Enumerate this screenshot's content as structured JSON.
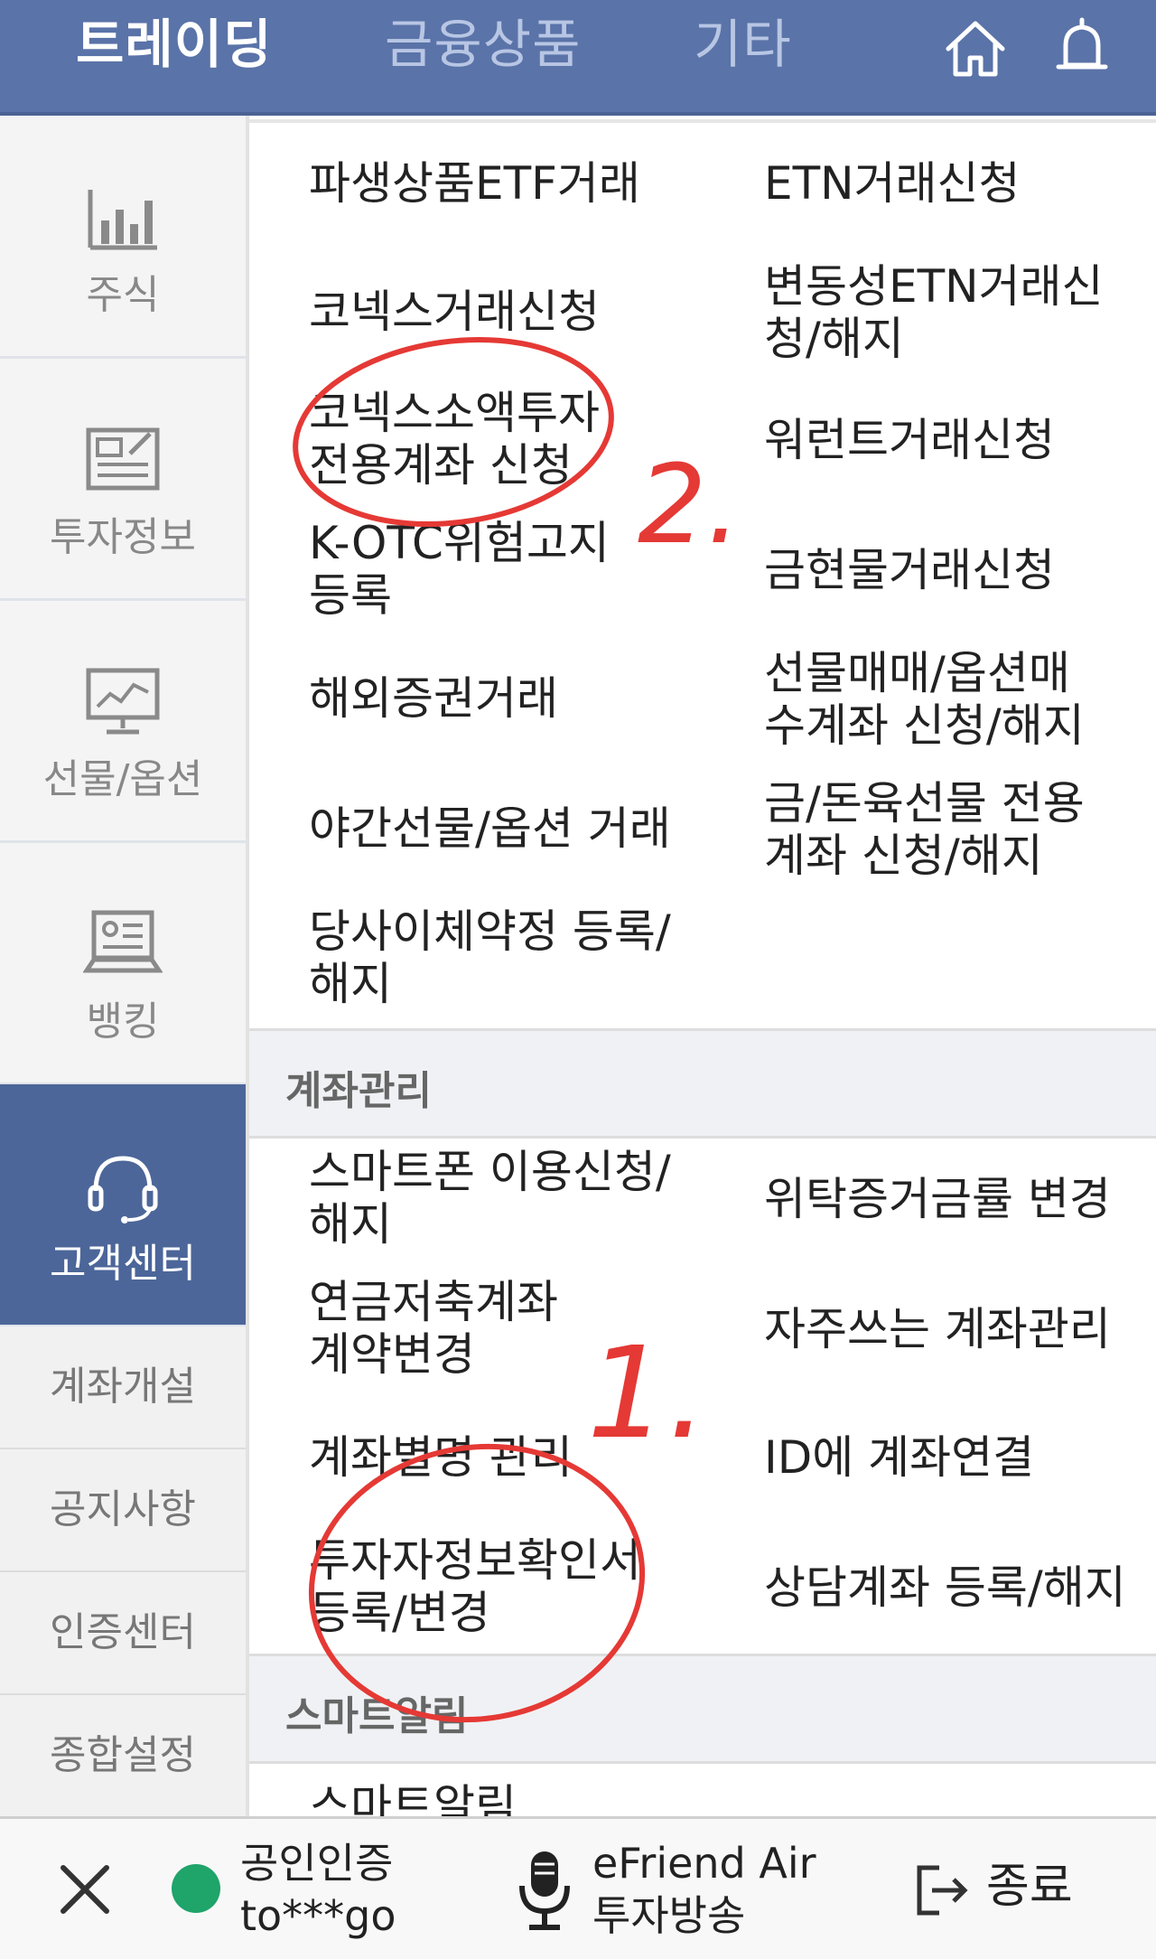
{
  "header": {
    "tabs": [
      {
        "label": "트레이딩",
        "active": true
      },
      {
        "label": "금융상품",
        "active": false
      },
      {
        "label": "기타",
        "active": false
      }
    ],
    "icons": [
      "home-icon",
      "bell-icon"
    ]
  },
  "sidebar": {
    "main_items": [
      {
        "label": "주식",
        "icon": "bar-chart-icon",
        "active": false
      },
      {
        "label": "투자정보",
        "icon": "news-icon",
        "active": false
      },
      {
        "label": "선물/옵션",
        "icon": "monitor-chart-icon",
        "active": false
      },
      {
        "label": "뱅킹",
        "icon": "laptop-card-icon",
        "active": false
      },
      {
        "label": "고객센터",
        "icon": "headset-icon",
        "active": true
      }
    ],
    "sub_items": [
      "계좌개설",
      "공지사항",
      "인증센터",
      "종합설정"
    ]
  },
  "content": {
    "group1": {
      "left": [
        [
          "파생상품ETF거래"
        ],
        [
          "코넥스거래신청"
        ],
        [
          "코넥스소액투자",
          "전용계좌 신청"
        ],
        [
          "K-OTC위험고지",
          "등록"
        ],
        [
          "해외증권거래"
        ],
        [
          "야간선물/옵션 거래"
        ],
        [
          "당사이체약정 등록/",
          "해지"
        ]
      ],
      "right": [
        [
          "ETN거래신청"
        ],
        [
          "변동성ETN거래신",
          "청/해지"
        ],
        [
          "워런트거래신청"
        ],
        [
          "금현물거래신청"
        ],
        [
          "선물매매/옵션매",
          "수계좌 신청/해지"
        ],
        [
          "금/돈육선물 전용",
          "계좌 신청/해지"
        ]
      ]
    },
    "section_account": "계좌관리",
    "group2": {
      "left": [
        [
          "스마트폰 이용신청/",
          "해지"
        ],
        [
          "연금저축계좌",
          "계약변경"
        ],
        [
          "계좌별명 관리"
        ],
        [
          "투자자정보확인서",
          "등록/변경"
        ]
      ],
      "right": [
        [
          "위탁증거금률 변경"
        ],
        [
          "자주쓰는 계좌관리"
        ],
        [
          "ID에 계좌연결"
        ],
        [
          "상담계좌 등록/해지"
        ]
      ]
    },
    "section_alert": "스마트알림",
    "partial_item": "스마트알림"
  },
  "bottombar": {
    "cert_label": "공인인증",
    "user_id": "to***go",
    "broadcast_line1": "eFriend Air",
    "broadcast_line2": "투자방송",
    "exit_label": "종료",
    "status_color": "#1fa46a"
  },
  "annotations": {
    "mark_1": "1.",
    "mark_2": "2.",
    "ink_color": "#e53935"
  }
}
